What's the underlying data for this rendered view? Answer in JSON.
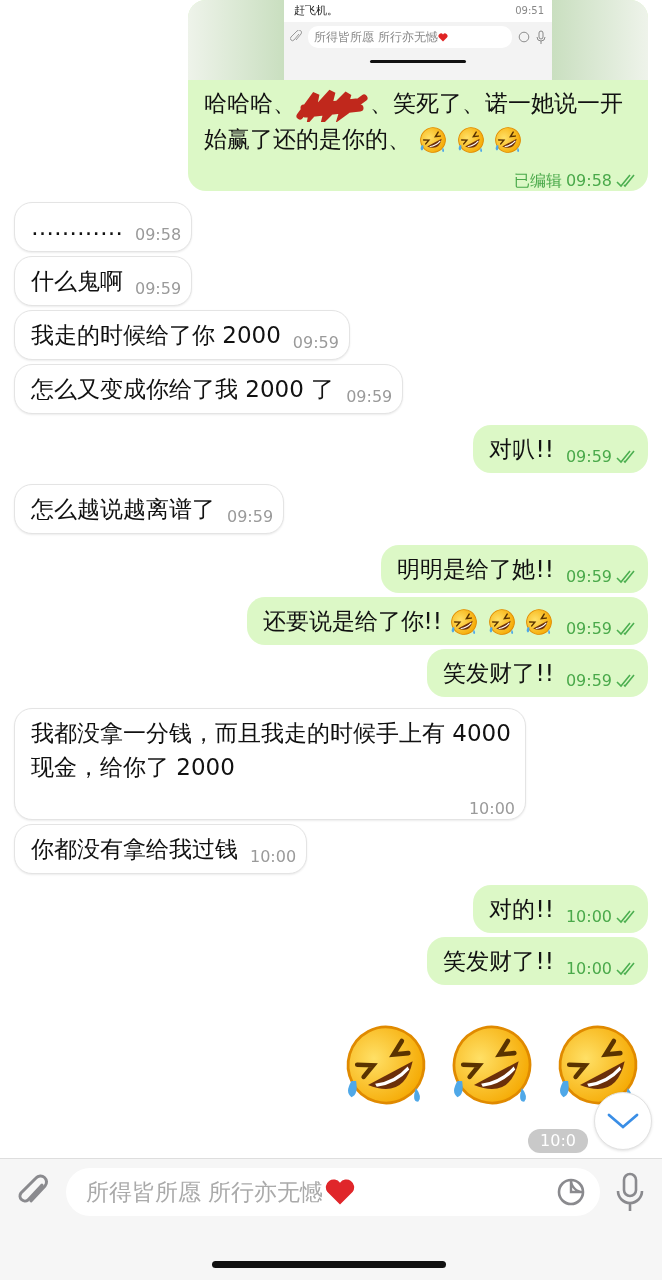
{
  "messages": [
    {
      "outgoing": true,
      "kind": "quoted-screenshot",
      "shot": {
        "text": "赶飞机。",
        "time": "09:51",
        "placeholder": "所得皆所愿 所行亦无憾"
      },
      "text": "哈哈哈、",
      "redacted": true,
      "text_after": "、笑死了、诺一她说一开始赢了还的是你的、",
      "emoji": [
        {
          "kind": "rofl"
        },
        {
          "kind": "rofl"
        },
        {
          "kind": "rofl"
        }
      ],
      "edited_label": "已编辑",
      "time": "09:58",
      "read": true
    },
    {
      "outgoing": false,
      "kind": "text",
      "text": "…………",
      "time": "09:58"
    },
    {
      "outgoing": false,
      "kind": "text",
      "text": "什么鬼啊",
      "time": "09:59"
    },
    {
      "outgoing": false,
      "kind": "text",
      "text": "我走的时候给了你 2000",
      "time": "09:59"
    },
    {
      "outgoing": false,
      "kind": "text",
      "text": "怎么又变成你给了我 2000 了",
      "time": "09:59"
    },
    {
      "outgoing": true,
      "kind": "text",
      "text": "对叭!!",
      "time": "09:59",
      "read": true
    },
    {
      "outgoing": false,
      "kind": "text",
      "text": "怎么越说越离谱了",
      "time": "09:59"
    },
    {
      "outgoing": true,
      "kind": "text",
      "text": "明明是给了她!!",
      "time": "09:59",
      "read": true
    },
    {
      "outgoing": true,
      "kind": "text",
      "text": "还要说是给了你!! ",
      "emoji": [
        {
          "kind": "rofl"
        },
        {
          "kind": "rofl"
        },
        {
          "kind": "rofl"
        }
      ],
      "time": "09:59",
      "read": true
    },
    {
      "outgoing": true,
      "kind": "text",
      "text": "笑发财了!!",
      "time": "09:59",
      "read": true
    },
    {
      "outgoing": false,
      "kind": "text",
      "text": "我都没拿一分钱，而且我走的时候手上有 4000 现金，给你了 2000",
      "time": "10:00"
    },
    {
      "outgoing": false,
      "kind": "text",
      "text": "你都没有拿给我过钱",
      "time": "10:00"
    },
    {
      "outgoing": true,
      "kind": "text",
      "text": "对的!!",
      "time": "10:00",
      "read": true
    },
    {
      "outgoing": true,
      "kind": "text",
      "text": "笑发财了!!",
      "time": "10:00",
      "read": true
    },
    {
      "outgoing": true,
      "kind": "big-emoji",
      "emoji": [
        {
          "kind": "rofl"
        },
        {
          "kind": "rofl"
        },
        {
          "kind": "rofl"
        }
      ],
      "time": "10:0"
    }
  ],
  "composer": {
    "placeholder": "所得皆所愿 所行亦无憾"
  }
}
